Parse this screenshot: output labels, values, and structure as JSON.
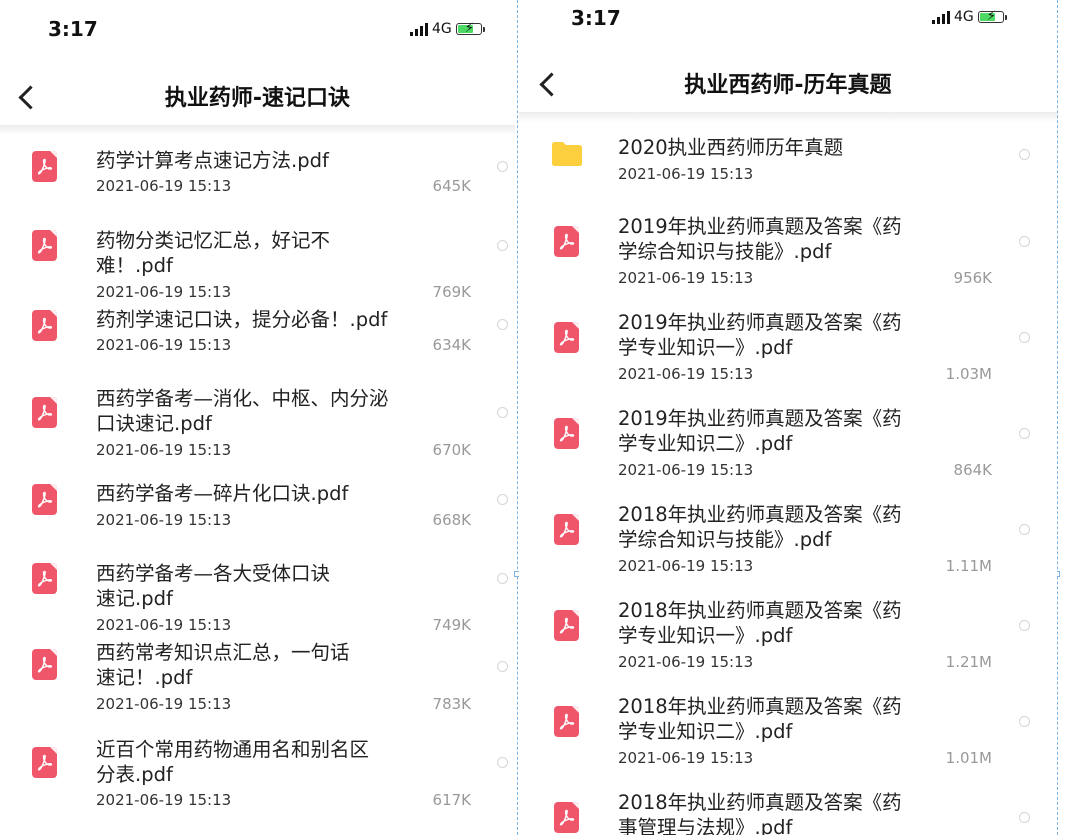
{
  "left": {
    "time": "3:17",
    "network": "4G",
    "title": "执业药师-速记口诀",
    "files": [
      {
        "name_lines": [
          "药学计算考点速记方法.pdf"
        ],
        "date": "2021-06-19 15:13",
        "size": "645K"
      },
      {
        "name_lines": [
          "药物分类记忆汇总，好记不",
          "难！.pdf"
        ],
        "date": "2021-06-19 15:13",
        "size": "769K"
      },
      {
        "name_lines": [
          "药剂学速记口诀，提分必备！.pdf"
        ],
        "date": "2021-06-19 15:13",
        "size": "634K"
      },
      {
        "name_lines": [
          "西药学备考—消化、中枢、内分泌",
          "口诀速记.pdf"
        ],
        "date": "2021-06-19 15:13",
        "size": "670K"
      },
      {
        "name_lines": [
          "西药学备考—碎片化口诀.pdf"
        ],
        "date": "2021-06-19 15:13",
        "size": "668K"
      },
      {
        "name_lines": [
          "西药学备考—各大受体口诀",
          "速记.pdf"
        ],
        "date": "2021-06-19 15:13",
        "size": "749K"
      },
      {
        "name_lines": [
          "西药常考知识点汇总，一句话",
          "速记！.pdf"
        ],
        "date": "2021-06-19 15:13",
        "size": "783K"
      },
      {
        "name_lines": [
          "近百个常用药物通用名和别名区",
          "分表.pdf"
        ],
        "date": "2021-06-19 15:13",
        "size": "617K"
      }
    ]
  },
  "right": {
    "time": "3:17",
    "network": "4G",
    "title": "执业西药师-历年真题",
    "folder": {
      "name": "2020执业西药师历年真题",
      "date": "2021-06-19 15:13"
    },
    "files": [
      {
        "name_lines": [
          "2019年执业药师真题及答案《药",
          "学综合知识与技能》.pdf"
        ],
        "date": "2021-06-19 15:13",
        "size": "956K"
      },
      {
        "name_lines": [
          "2019年执业药师真题及答案《药",
          "学专业知识一》.pdf"
        ],
        "date": "2021-06-19 15:13",
        "size": "1.03M"
      },
      {
        "name_lines": [
          "2019年执业药师真题及答案《药",
          "学专业知识二》.pdf"
        ],
        "date": "2021-06-19 15:13",
        "size": "864K"
      },
      {
        "name_lines": [
          "2018年执业药师真题及答案《药",
          "学综合知识与技能》.pdf"
        ],
        "date": "2021-06-19 15:13",
        "size": "1.11M"
      },
      {
        "name_lines": [
          "2018年执业药师真题及答案《药",
          "学专业知识一》.pdf"
        ],
        "date": "2021-06-19 15:13",
        "size": "1.21M"
      },
      {
        "name_lines": [
          "2018年执业药师真题及答案《药",
          "学专业知识二》.pdf"
        ],
        "date": "2021-06-19 15:13",
        "size": "1.01M"
      },
      {
        "name_lines": [
          "2018年执业药师真题及答案《药",
          "事管理与法规》.pdf"
        ],
        "date": "",
        "size": ""
      }
    ]
  },
  "colors": {
    "pdf": "#f0566a",
    "folder": "#fbcf3d",
    "divider": "#7db3e0"
  }
}
